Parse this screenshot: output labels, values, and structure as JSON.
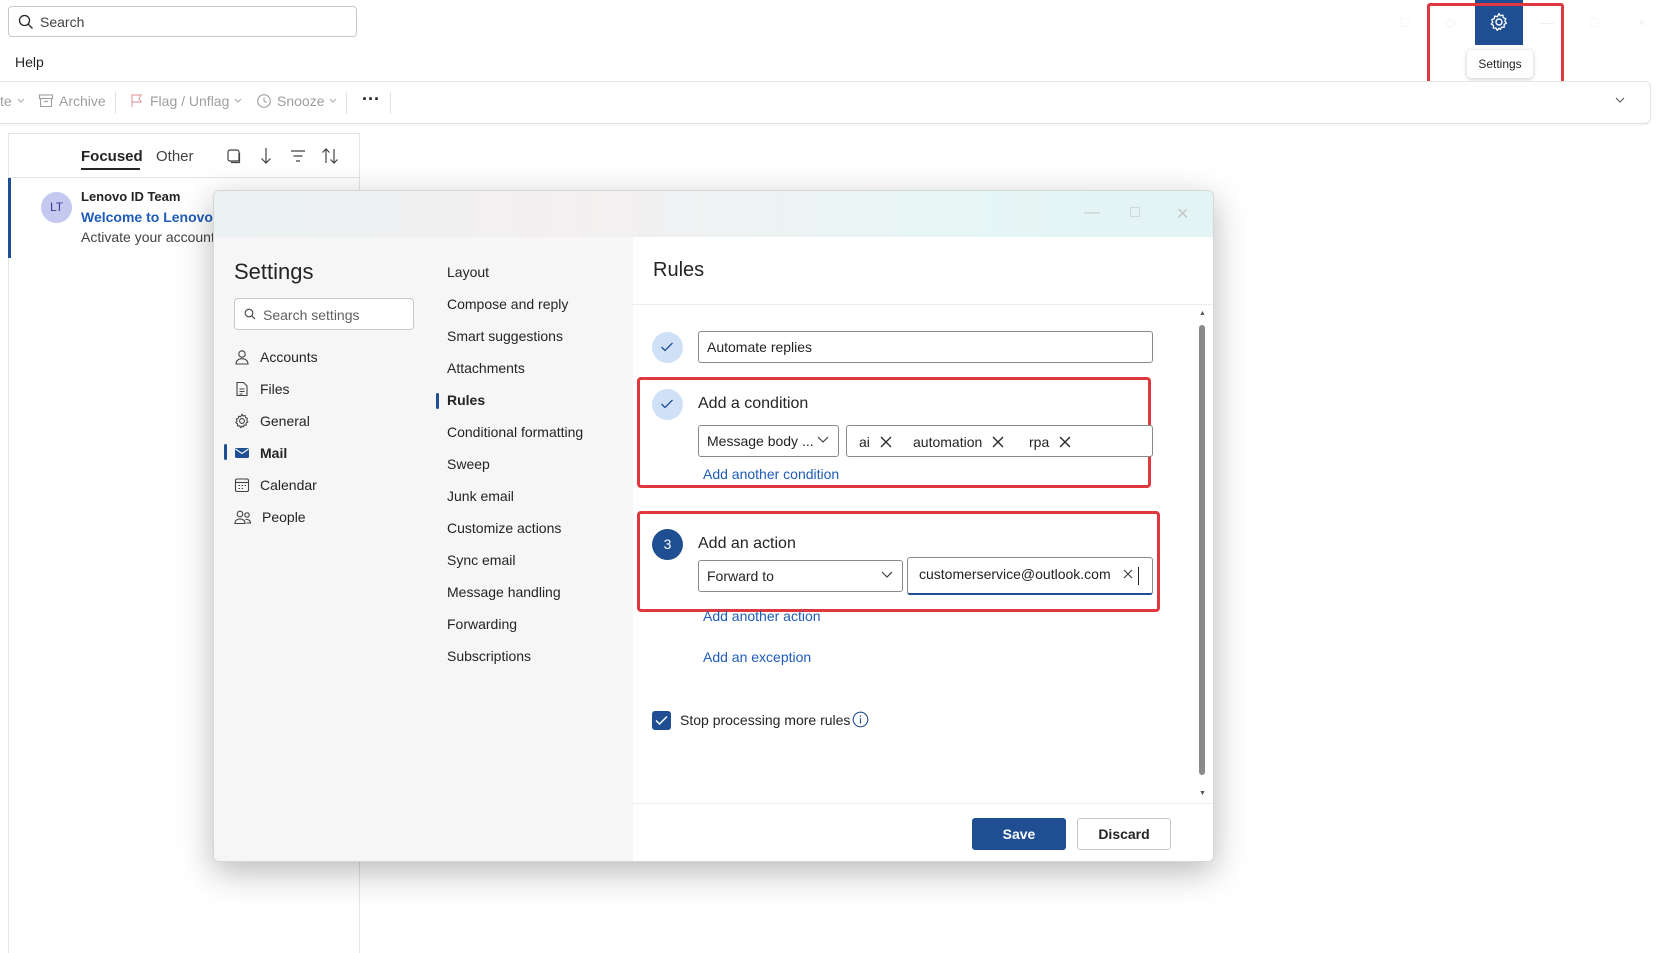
{
  "topbar": {
    "search_placeholder": "Search",
    "menu_help": "Help",
    "settings_tooltip": "Settings",
    "accent": "#1f4e93"
  },
  "ribbon": {
    "partial_label": "te",
    "archive": "Archive",
    "flag": "Flag / Unflag",
    "snooze": "Snooze",
    "more": "···"
  },
  "message_list": {
    "tab_focused": "Focused",
    "tab_other": "Other",
    "message": {
      "initials": "LT",
      "sender": "Lenovo ID Team",
      "subject": "Welcome to Lenovo I",
      "preview": "Activate your account"
    }
  },
  "settings": {
    "title": "Settings",
    "search_placeholder": "Search settings",
    "categories": [
      {
        "label": "Accounts",
        "icon": "person-icon"
      },
      {
        "label": "Files",
        "icon": "file-icon"
      },
      {
        "label": "General",
        "icon": "gear-icon"
      },
      {
        "label": "Mail",
        "icon": "mail-icon",
        "selected": true
      },
      {
        "label": "Calendar",
        "icon": "calendar-icon"
      },
      {
        "label": "People",
        "icon": "people-icon"
      }
    ],
    "mail_sections": [
      "Layout",
      "Compose and reply",
      "Smart suggestions",
      "Attachments",
      "Rules",
      "Conditional formatting",
      "Sweep",
      "Junk email",
      "Customize actions",
      "Sync email",
      "Message handling",
      "Forwarding",
      "Subscriptions"
    ],
    "selected_section": "Rules"
  },
  "rules": {
    "title": "Rules",
    "rule_name": "Automate replies",
    "condition": {
      "label": "Add a condition",
      "type": "Message body ...",
      "keywords": [
        "ai",
        "automation",
        "rpa"
      ],
      "add_another": "Add another condition"
    },
    "action": {
      "step": "3",
      "label": "Add an action",
      "type": "Forward to",
      "recipient": "customerservice@outlook.com",
      "add_another": "Add another action"
    },
    "add_exception": "Add an exception",
    "stop_processing": {
      "label": "Stop processing more rules",
      "checked": true
    },
    "save": "Save",
    "discard": "Discard"
  }
}
